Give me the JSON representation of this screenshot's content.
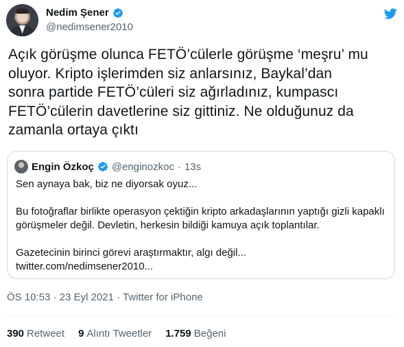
{
  "author": {
    "name": "Nedim Şener",
    "handle": "@nedimsener2010"
  },
  "tweet": {
    "lines": [
      "Açık görüşme olunca FETÖ’cülerle görüşme ‘meşru’ mu",
      "oluyor. Kripto işlerimden siz anlarsınız, Baykal’dan",
      "sonra partide FETÖ’cüleri siz ağırladınız, kumpascı",
      "FETÖ’cülerin davetlerine siz gittiniz. Ne olduğunuz da",
      "zamanla ortaya çıktı"
    ]
  },
  "quote": {
    "name": "Engin Özkoç",
    "handle": "@enginozkoc",
    "separator": "·",
    "time": "13s",
    "p1": "Sen aynaya bak, biz ne diyorsak oyuz...",
    "p2a": "Bu fotoğraflar birlikte operasyon çektiğin kripto arkadaşlarının yaptığı gizli kapaklı",
    "p2b": "görüşmeler değil. Devletin, herkesin bildiği kamuya açık toplantılar.",
    "p3": "Gazetecinin birinci görevi araştırmaktır, algı değil...",
    "link": "twitter.com/nedimsener2010..."
  },
  "meta": {
    "time": "ÖS 10:53",
    "sep": "·",
    "date": "23 Eyl 2021",
    "source": "Twitter for iPhone"
  },
  "stats": {
    "retweets": {
      "count": "390",
      "label": "Retweet"
    },
    "quotes": {
      "count": "9",
      "label": "Alıntı Tweetler"
    },
    "likes": {
      "count": "1.759",
      "label": "Beğeni"
    }
  },
  "colors": {
    "verified": "#1d9bf0",
    "twitter_blue": "#1d9bf0",
    "muted_text": "#536471",
    "border": "#cfd9de"
  },
  "icons": [
    "verified-badge-icon",
    "twitter-bird-icon"
  ]
}
